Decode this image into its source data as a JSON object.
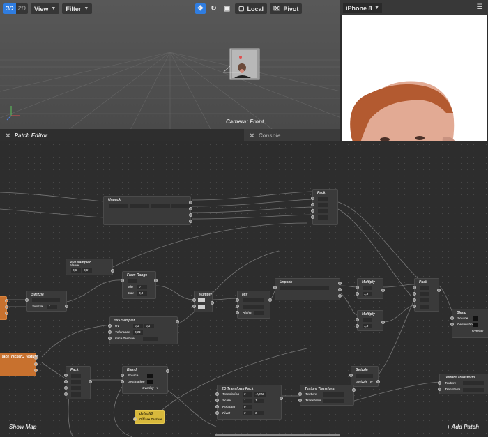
{
  "toolbar": {
    "mode_3d": "3D",
    "mode_2d": "2D",
    "view_label": "View",
    "filter_label": "Filter",
    "local_label": "Local",
    "pivot_label": "Pivot"
  },
  "viewport": {
    "camera_label": "Camera: Front"
  },
  "simulator": {
    "device": "iPhone 8"
  },
  "panels": {
    "patch_editor": "Patch Editor",
    "console": "Console"
  },
  "footer": {
    "show_map": "Show Map",
    "add_patch": "+ Add Patch"
  },
  "nodes": {
    "unpack1": {
      "title": "Unpack"
    },
    "pack_top": {
      "title": "Pack"
    },
    "eye_sampler": {
      "title": "eye sampler",
      "sub": "Value",
      "v1": "0,5",
      "v2": "0,5"
    },
    "from_range": {
      "title": "From Range",
      "min_label": "Min",
      "min_val": "0",
      "max_label": "Max",
      "max_val": "0,1"
    },
    "swizzle1": {
      "title": "Swizzle",
      "label": "Swizzle",
      "val": "t"
    },
    "multiply1": {
      "title": "Multiply"
    },
    "mix": {
      "title": "Mix",
      "alpha": "Alpha"
    },
    "unpack2": {
      "title": "Unpack"
    },
    "multiply2": {
      "title": "Multiply",
      "val": "1,5"
    },
    "multiply3": {
      "title": "Multiply",
      "val": "1,5"
    },
    "pack_right": {
      "title": "Pack"
    },
    "blend_right": {
      "title": "Blend",
      "src": "Source",
      "dst": "Destination",
      "mode": "Overlay"
    },
    "sampler5": {
      "title": "5x5 Sampler",
      "uv": "UV",
      "uv1": "0,1",
      "uv2": "0,1",
      "tol": "Tolerance",
      "tol_val": "0,01",
      "face": "Face Texture"
    },
    "face_tex": {
      "title": "faceTrackerO Texture"
    },
    "pack2": {
      "title": "Pack"
    },
    "blend2": {
      "title": "Blend",
      "src": "Source",
      "dst": "Destination",
      "mode": "Overlay"
    },
    "swizzle2": {
      "title": "Swizzle",
      "label": "Swizzle",
      "val": "w"
    },
    "transform2d": {
      "title": "2D Transform Pack",
      "translation": "Translation",
      "t1": "0",
      "t2": "-0,022",
      "scale": "Scale",
      "s1": "1",
      "s2": "1",
      "rotation": "Rotation",
      "r1": "0",
      "pivot": "Pivot",
      "p1": "0",
      "p2": "0"
    },
    "tt1": {
      "title": "Texture Transform",
      "texture": "Texture",
      "transform": "Transform"
    },
    "tt2": {
      "title": "Texture Transform",
      "texture": "Texture",
      "transform": "Transform"
    },
    "default0": {
      "title": "default0",
      "sub": "Diffuse Texture"
    }
  },
  "colors": {
    "accent": "#2f7de1",
    "node_bg": "#3a3a3a",
    "texture_node": "#c8712e",
    "material_node": "#d8b93c"
  }
}
